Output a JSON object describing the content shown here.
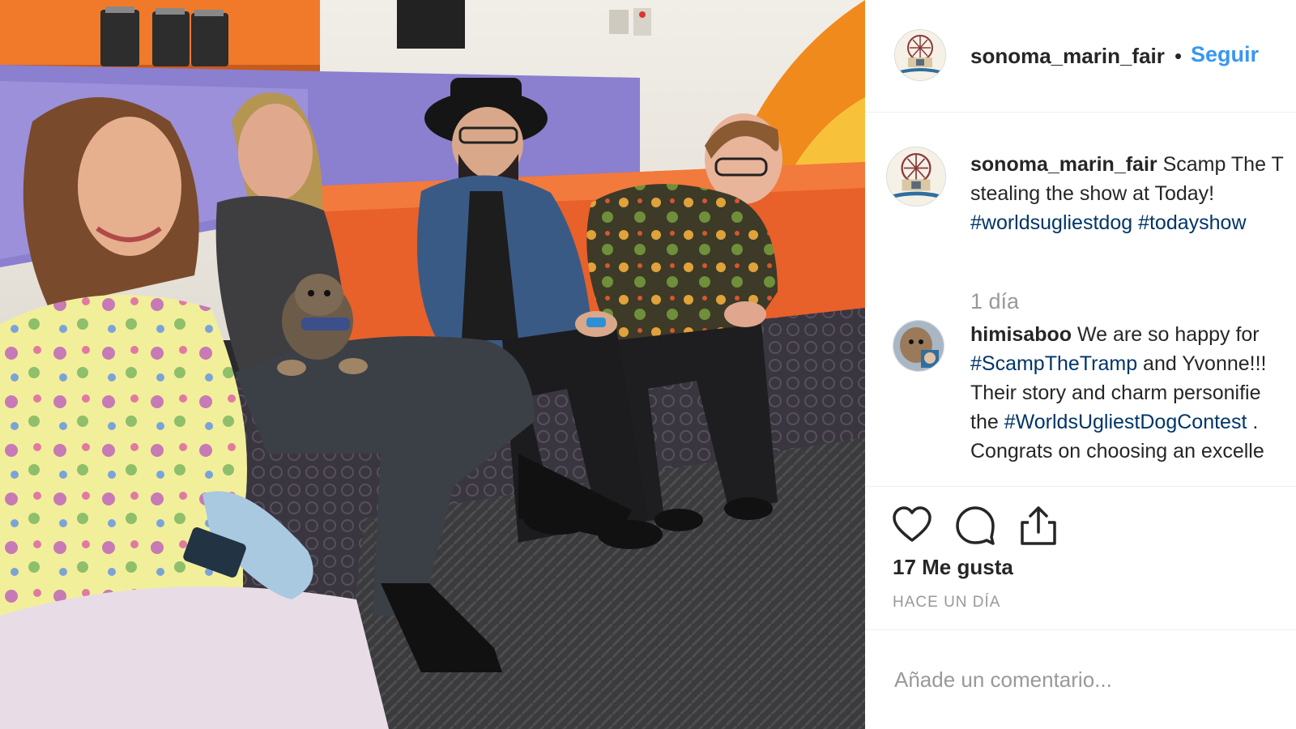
{
  "photo": {
    "icon": "photo-image"
  },
  "post": {
    "username": "sonoma_marin_fair",
    "separator": "•",
    "follow_label": "Seguir",
    "caption": {
      "username": "sonoma_marin_fair",
      "line1": "Scamp The T",
      "line2": "stealing the show at Today!",
      "tag1": "#worldsugliestdog",
      "tag2": "#todayshow",
      "time": "1 día"
    },
    "comments": [
      {
        "username": "himisaboo",
        "text1": "We are so happy for",
        "tag1": "#ScampTheTramp",
        "text2": "and Yvonne!!!",
        "line3": "Their story and charm personifie",
        "text4": "the",
        "tag2": "#WorldsUgliestDogContest",
        "text4b": ".",
        "line5": "Congrats on choosing an excelle"
      }
    ],
    "likes": "17 Me gusta",
    "date": "HACE UN DÍA",
    "comment_placeholder": "Añade un comentario..."
  },
  "icons": {
    "like": "heart-icon",
    "comment": "comment-icon",
    "share": "share-icon"
  },
  "colors": {
    "link": "#3897f0",
    "hashtag": "#003569",
    "text": "#262626",
    "muted": "#999999",
    "divider": "#efefef"
  }
}
